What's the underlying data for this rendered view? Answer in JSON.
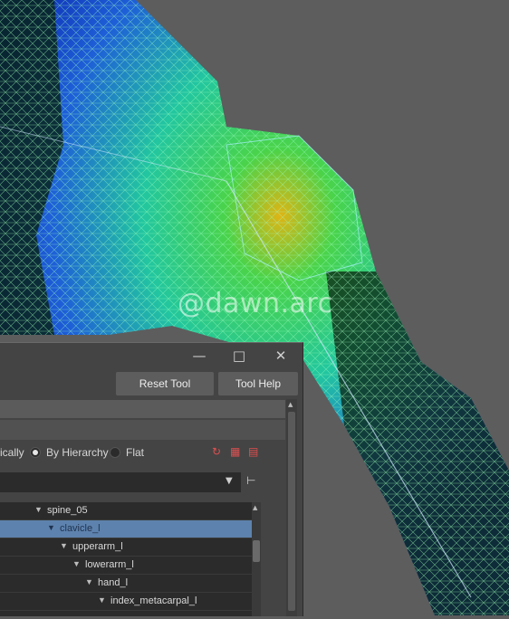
{
  "watermark": "@dawn.arc",
  "window": {
    "minimize_icon": "minimize-icon",
    "maximize_icon": "maximize-icon",
    "close_icon": "close-icon"
  },
  "toolbar": {
    "reset_tool": "Reset Tool",
    "tool_help": "Tool Help"
  },
  "sort": {
    "alphabetically_partial": "ically",
    "by_hierarchy": "By Hierarchy",
    "flat": "Flat",
    "selected": "By Hierarchy"
  },
  "tree": {
    "rows": [
      {
        "label": "spine_05",
        "depth": 0,
        "selected": false
      },
      {
        "label": "clavicle_l",
        "depth": 1,
        "selected": true
      },
      {
        "label": "upperarm_l",
        "depth": 2,
        "selected": false
      },
      {
        "label": "lowerarm_l",
        "depth": 3,
        "selected": false
      },
      {
        "label": "hand_l",
        "depth": 4,
        "selected": false
      },
      {
        "label": "index_metacarpal_l",
        "depth": 5,
        "selected": false
      }
    ]
  },
  "colors": {
    "selection": "#5d82ad",
    "panel": "#444444",
    "viewport_bg": "#5d5d5d"
  }
}
